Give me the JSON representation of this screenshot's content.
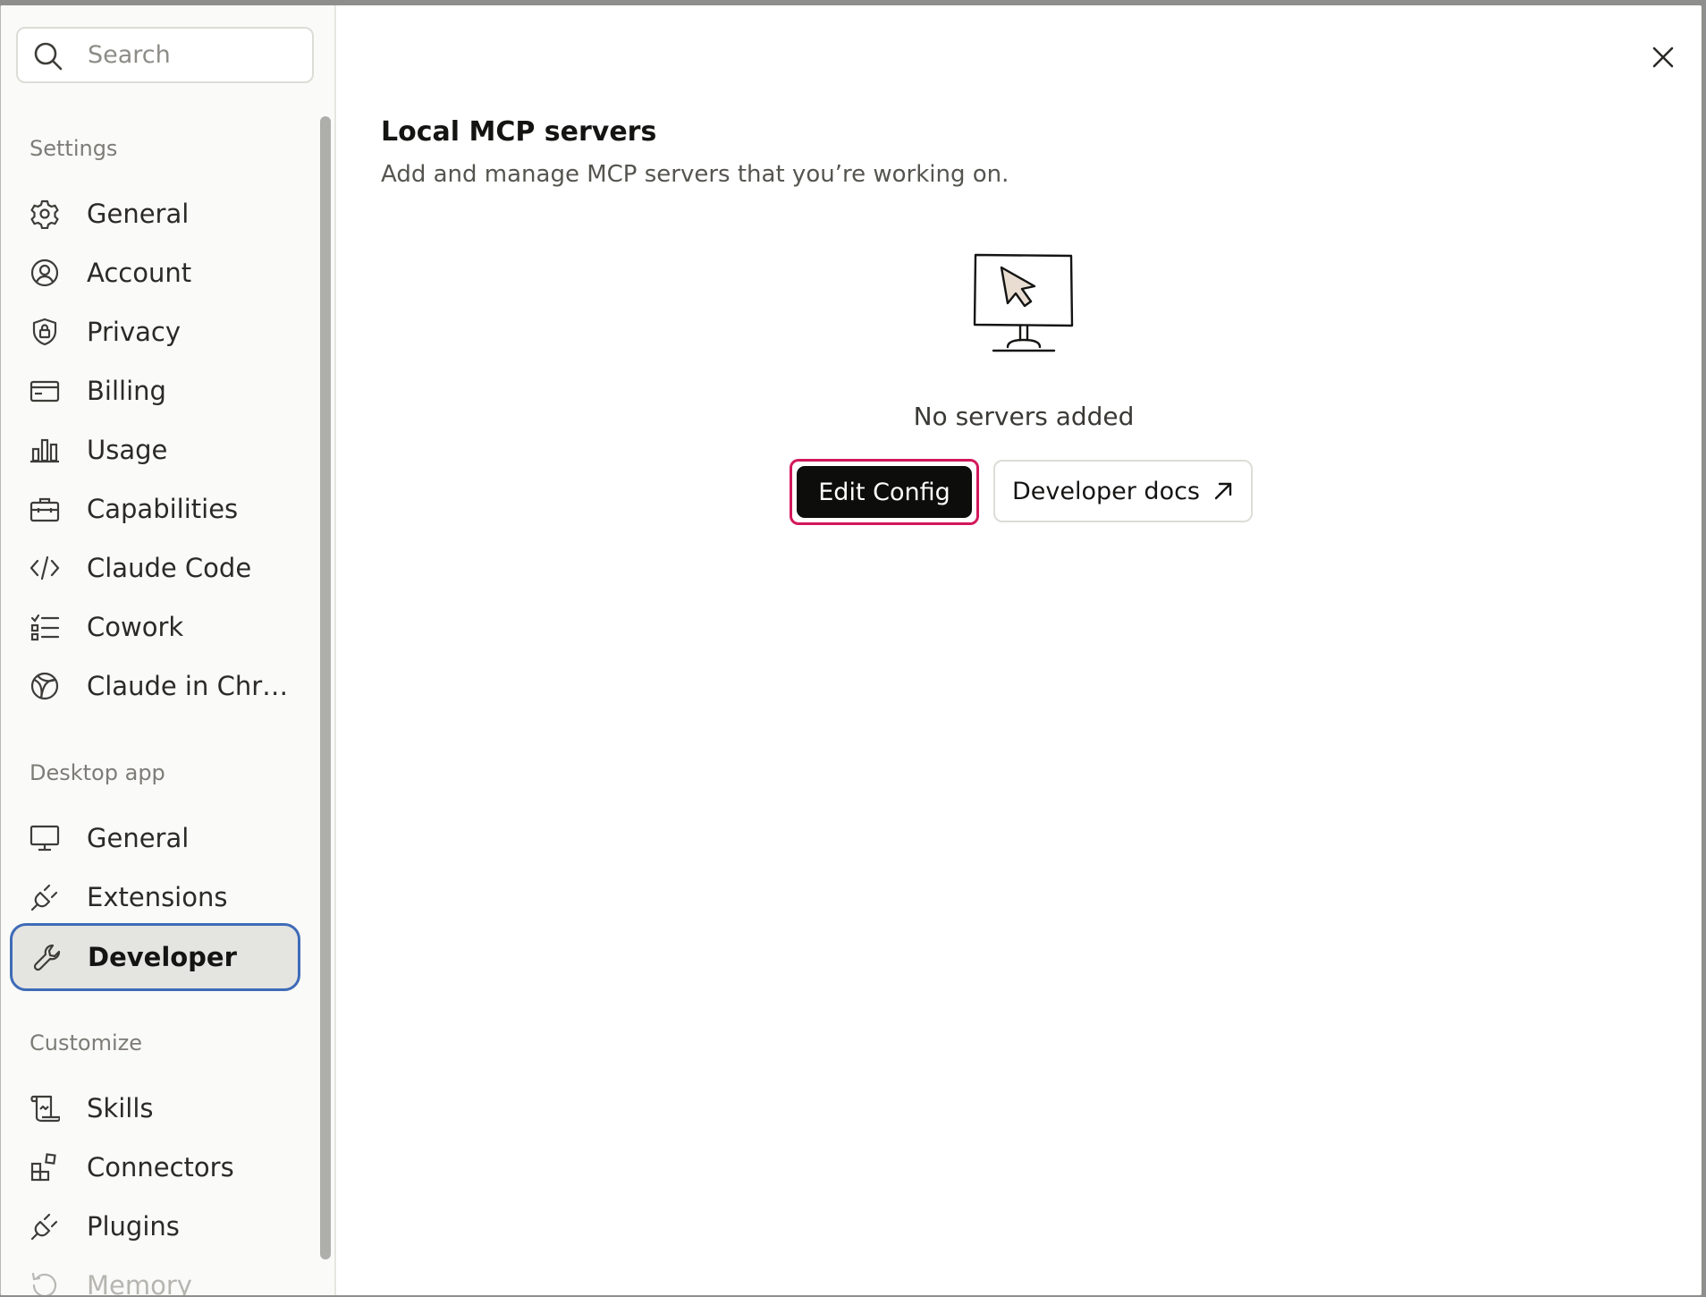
{
  "search": {
    "placeholder": "Search"
  },
  "sidebar": {
    "sections": [
      {
        "label": "Settings"
      },
      {
        "label": "Desktop app"
      },
      {
        "label": "Customize"
      }
    ],
    "settings_items": [
      {
        "label": "General",
        "icon": "gear-icon"
      },
      {
        "label": "Account",
        "icon": "user-circle-icon"
      },
      {
        "label": "Privacy",
        "icon": "shield-lock-icon"
      },
      {
        "label": "Billing",
        "icon": "credit-card-icon"
      },
      {
        "label": "Usage",
        "icon": "bar-chart-icon"
      },
      {
        "label": "Capabilities",
        "icon": "briefcase-icon"
      },
      {
        "label": "Claude Code",
        "icon": "code-brackets-icon"
      },
      {
        "label": "Cowork",
        "icon": "checklist-icon"
      },
      {
        "label": "Claude in Chr…",
        "icon": "globe-icon"
      }
    ],
    "desktop_items": [
      {
        "label": "General",
        "icon": "monitor-icon"
      },
      {
        "label": "Extensions",
        "icon": "plug-icon"
      },
      {
        "label": "Developer",
        "icon": "wrench-icon",
        "active": true
      }
    ],
    "customize_items": [
      {
        "label": "Skills",
        "icon": "scroll-icon"
      },
      {
        "label": "Connectors",
        "icon": "blocks-icon"
      },
      {
        "label": "Plugins",
        "icon": "plug-icon"
      },
      {
        "label": "Memory",
        "icon": "history-icon"
      }
    ]
  },
  "main": {
    "title": "Local MCP servers",
    "subtitle": "Add and manage MCP servers that you’re working on.",
    "empty_state": {
      "icon": "monitor-cursor-illustration",
      "text": "No servers added"
    },
    "edit_config_label": "Edit Config",
    "developer_docs_label": "Developer docs"
  },
  "colors": {
    "active_outline": "#3e6bb7",
    "focus_ring": "#d3185a",
    "primary_button": "#0d0d0c",
    "sidebar_bg": "#fafaf8"
  }
}
